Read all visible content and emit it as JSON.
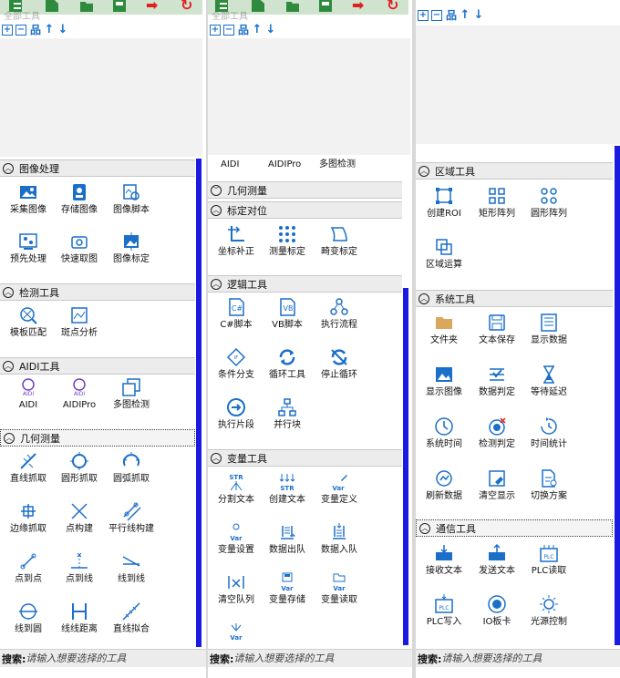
{
  "accent_color": "#1a6fc9",
  "panels": [
    {
      "tab_title": "全部工具",
      "search": {
        "label": "搜索:",
        "placeholder": "请输入想要选择的工具"
      },
      "sections": [
        {
          "label": "图像处理",
          "toggle": "up",
          "items": [
            {
              "label": "采集图像",
              "icon": "image-icon"
            },
            {
              "label": "存储图像",
              "icon": "save-image-icon"
            },
            {
              "label": "图像脚本",
              "icon": "image-script-icon"
            },
            {
              "label": "预先处理",
              "icon": "preprocess-icon"
            },
            {
              "label": "快速取图",
              "icon": "camera-icon"
            },
            {
              "label": "图像标定",
              "icon": "calibrate-image-icon"
            }
          ]
        },
        {
          "label": "检测工具",
          "toggle": "up",
          "items": [
            {
              "label": "模板匹配",
              "icon": "template-match-icon"
            },
            {
              "label": "斑点分析",
              "icon": "blob-icon"
            }
          ]
        },
        {
          "label": "AIDI工具",
          "toggle": "up",
          "items": [
            {
              "label": "AIDI",
              "icon": "aidi-icon"
            },
            {
              "label": "AIDIPro",
              "icon": "aidi-pro-icon"
            },
            {
              "label": "多图检测",
              "icon": "multi-image-icon"
            }
          ]
        },
        {
          "label": "几何测量",
          "toggle": "up",
          "items": [
            {
              "label": "直线抓取",
              "icon": "line-grab-icon"
            },
            {
              "label": "圆形抓取",
              "icon": "circle-grab-icon"
            },
            {
              "label": "圆弧抓取",
              "icon": "arc-grab-icon"
            },
            {
              "label": "边缘抓取",
              "icon": "edge-grab-icon"
            },
            {
              "label": "点构建",
              "icon": "point-build-icon"
            },
            {
              "label": "平行线构建",
              "icon": "parallel-icon"
            },
            {
              "label": "点到点",
              "icon": "point-point-icon"
            },
            {
              "label": "点到线",
              "icon": "point-line-icon"
            },
            {
              "label": "线到线",
              "icon": "line-line-icon"
            },
            {
              "label": "线到圆",
              "icon": "line-circle-icon"
            },
            {
              "label": "线线距离",
              "icon": "line-distance-icon"
            },
            {
              "label": "直线拟合",
              "icon": "line-fit-icon"
            }
          ]
        }
      ]
    },
    {
      "tab_title": "全部工具",
      "search": {
        "label": "搜索:",
        "placeholder": "请输入想要选择的工具"
      },
      "partial_items": [
        {
          "label": "AIDI"
        },
        {
          "label": "AIDIPro"
        },
        {
          "label": "多图检测"
        }
      ],
      "sections": [
        {
          "label": "几何测量",
          "toggle": "down",
          "items": []
        },
        {
          "label": "标定对位",
          "toggle": "up",
          "items": [
            {
              "label": "坐标补正",
              "icon": "coord-fix-icon"
            },
            {
              "label": "测量标定",
              "icon": "measure-calib-icon"
            },
            {
              "label": "畸变标定",
              "icon": "distortion-icon"
            }
          ]
        },
        {
          "label": "逻辑工具",
          "toggle": "up",
          "items": [
            {
              "label": "C#脚本",
              "icon": "csharp-icon"
            },
            {
              "label": "VB脚本",
              "icon": "vb-icon"
            },
            {
              "label": "执行流程",
              "icon": "flow-icon"
            },
            {
              "label": "条件分支",
              "icon": "branch-icon"
            },
            {
              "label": "循环工具",
              "icon": "loop-icon"
            },
            {
              "label": "停止循环",
              "icon": "stop-loop-icon"
            },
            {
              "label": "执行片段",
              "icon": "run-fragment-icon"
            },
            {
              "label": "并行块",
              "icon": "parallel-block-icon"
            }
          ]
        },
        {
          "label": "变量工具",
          "toggle": "up",
          "items": [
            {
              "label": "分割文本",
              "icon": "split-text-icon"
            },
            {
              "label": "创建文本",
              "icon": "create-text-icon"
            },
            {
              "label": "变量定义",
              "icon": "var-define-icon"
            },
            {
              "label": "变量设置",
              "icon": "var-set-icon"
            },
            {
              "label": "数据出队",
              "icon": "dequeue-icon"
            },
            {
              "label": "数据入队",
              "icon": "enqueue-icon"
            },
            {
              "label": "清空队列",
              "icon": "clear-queue-icon"
            },
            {
              "label": "变量存储",
              "icon": "var-store-icon"
            },
            {
              "label": "变量读取",
              "icon": "var-read-icon"
            },
            {
              "label": "",
              "icon": "var-icon"
            }
          ]
        }
      ]
    },
    {
      "search": {
        "label": "搜索:",
        "placeholder": "请输入想要选择的工具"
      },
      "sections": [
        {
          "label": "区域工具",
          "toggle": "up",
          "items": [
            {
              "label": "创建ROI",
              "icon": "roi-icon"
            },
            {
              "label": "矩形阵列",
              "icon": "rect-array-icon"
            },
            {
              "label": "圆形阵列",
              "icon": "circle-array-icon"
            },
            {
              "label": "区域运算",
              "icon": "region-op-icon"
            }
          ]
        },
        {
          "label": "系统工具",
          "toggle": "up",
          "items": [
            {
              "label": "文件夹",
              "icon": "folder-icon"
            },
            {
              "label": "文本保存",
              "icon": "text-save-icon"
            },
            {
              "label": "显示数据",
              "icon": "show-data-icon"
            },
            {
              "label": "显示图像",
              "icon": "show-image-icon"
            },
            {
              "label": "数据判定",
              "icon": "data-judge-icon"
            },
            {
              "label": "等待延迟",
              "icon": "hourglass-icon"
            },
            {
              "label": "系统时间",
              "icon": "clock-icon"
            },
            {
              "label": "检测判定",
              "icon": "detect-judge-icon"
            },
            {
              "label": "时间统计",
              "icon": "time-stat-icon"
            },
            {
              "label": "刷新数据",
              "icon": "refresh-icon"
            },
            {
              "label": "清空显示",
              "icon": "clear-display-icon"
            },
            {
              "label": "切换方案",
              "icon": "switch-plan-icon"
            }
          ]
        },
        {
          "label": "通信工具",
          "toggle": "up",
          "items": [
            {
              "label": "接收文本",
              "icon": "receive-text-icon"
            },
            {
              "label": "发送文本",
              "icon": "send-text-icon"
            },
            {
              "label": "PLC读取",
              "icon": "plc-read-icon"
            },
            {
              "label": "PLC写入",
              "icon": "plc-write-icon"
            },
            {
              "label": "IO板卡",
              "icon": "io-card-icon"
            },
            {
              "label": "光源控制",
              "icon": "light-icon"
            }
          ]
        }
      ]
    }
  ]
}
